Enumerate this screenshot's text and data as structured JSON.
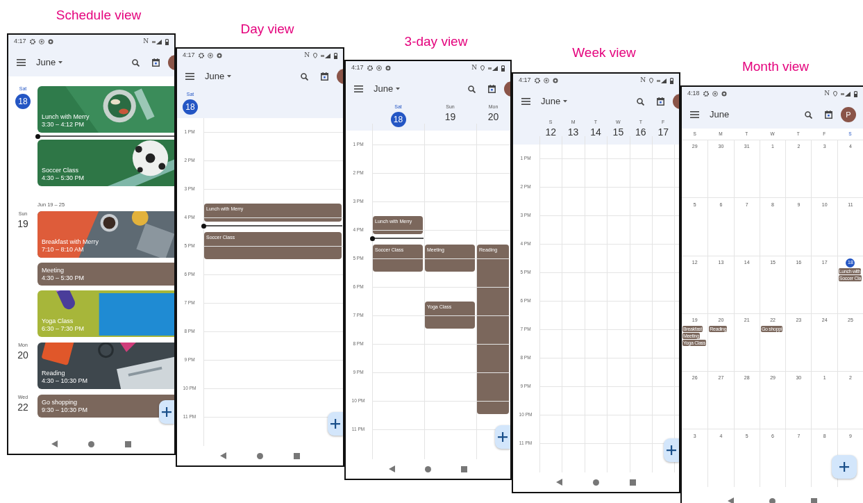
{
  "views": [
    {
      "kind": "schedule",
      "caption": "Schedule view",
      "time": "4:17",
      "nfc": "N",
      "location": false,
      "month": "June",
      "dropdown": true,
      "agenda": [
        {
          "kind": "day",
          "weekday": "Sat",
          "date": "18",
          "today": true,
          "events": [
            {
              "kind": "picture",
              "title": "Lunch with Merry",
              "time": "3:30 – 4:12 PM"
            },
            {
              "kind": "now"
            },
            {
              "kind": "picture",
              "title": "Soccer Class",
              "time": "4:30 – 5:30 PM"
            }
          ]
        },
        {
          "kind": "range",
          "label": "Jun 19 – 25"
        },
        {
          "kind": "day",
          "weekday": "Sun",
          "date": "19",
          "today": false,
          "events": [
            {
              "kind": "picture",
              "title": "Breakfast with Merry",
              "time": "7:10 – 8:10 AM"
            },
            {
              "kind": "plain",
              "title": "Meeting",
              "time": "4:30 – 5:30 PM"
            },
            {
              "kind": "picture",
              "title": "Yoga Class",
              "time": "6:30 – 7:30 PM"
            }
          ]
        },
        {
          "kind": "day",
          "weekday": "Mon",
          "date": "20",
          "today": false,
          "events": [
            {
              "kind": "picture",
              "title": "Reading",
              "time": "4:30 – 10:30 PM"
            }
          ]
        },
        {
          "kind": "day",
          "weekday": "Wed",
          "date": "22",
          "today": false,
          "events": [
            {
              "kind": "plain",
              "title": "Go shopping",
              "time": "9:30 – 10:30 PM"
            }
          ]
        }
      ]
    },
    {
      "kind": "day",
      "caption": "Day view",
      "time": "4:17",
      "nfc": "N",
      "location": true,
      "month": "June",
      "dropdown": true,
      "hours": [
        "1 PM",
        "2 PM",
        "3 PM",
        "4 PM",
        "5 PM",
        "6 PM",
        "7 PM",
        "8 PM",
        "9 PM",
        "10 PM",
        "11 PM"
      ],
      "days": [
        {
          "weekday": "Sat",
          "date": "18",
          "today": true,
          "now_line": true,
          "events": [
            {
              "title": "Lunch with Merry"
            },
            {
              "title": "Soccer Class"
            }
          ]
        }
      ]
    },
    {
      "kind": "threeday",
      "caption": "3-day view",
      "time": "4:17",
      "nfc": "N",
      "location": true,
      "month": "June",
      "dropdown": true,
      "hours": [
        "1 PM",
        "2 PM",
        "3 PM",
        "4 PM",
        "5 PM",
        "6 PM",
        "7 PM",
        "8 PM",
        "9 PM",
        "10 PM",
        "11 PM"
      ],
      "days": [
        {
          "weekday": "Sat",
          "date": "18",
          "today": true,
          "now_line": true,
          "events": [
            {
              "title": "Lunch with Merry"
            },
            {
              "title": "Soccer Class"
            }
          ]
        },
        {
          "weekday": "Sun",
          "date": "19",
          "today": false,
          "now_line": false,
          "events": [
            {
              "title": "Meeting"
            },
            {
              "title": "Yoga Class"
            }
          ]
        },
        {
          "weekday": "Mon",
          "date": "20",
          "today": false,
          "now_line": false,
          "events": [
            {
              "title": "Reading"
            }
          ]
        }
      ]
    },
    {
      "kind": "week",
      "caption": "Week view",
      "time": "4:17",
      "nfc": "N",
      "location": true,
      "month": "June",
      "dropdown": true,
      "hours": [
        "1 PM",
        "2 PM",
        "3 PM",
        "4 PM",
        "5 PM",
        "6 PM",
        "7 PM",
        "8 PM",
        "9 PM",
        "10 PM",
        "11 PM"
      ],
      "days": [
        {
          "weekday": "S",
          "date": "12",
          "today": false,
          "now_line": false
        },
        {
          "weekday": "M",
          "date": "13",
          "today": false,
          "now_line": false
        },
        {
          "weekday": "T",
          "date": "14",
          "today": false,
          "now_line": false
        },
        {
          "weekday": "W",
          "date": "15",
          "today": false,
          "now_line": false
        },
        {
          "weekday": "T",
          "date": "16",
          "today": false,
          "now_line": false
        },
        {
          "weekday": "F",
          "date": "17",
          "today": false,
          "now_line": false
        }
      ]
    },
    {
      "kind": "month",
      "caption": "Month view",
      "time": "4:18",
      "nfc": "N",
      "location": true,
      "month": "June",
      "dropdown": false,
      "avatar": "P",
      "weekdays": [
        {
          "label": "S",
          "today": false
        },
        {
          "label": "M",
          "today": false
        },
        {
          "label": "T",
          "today": false
        },
        {
          "label": "W",
          "today": false
        },
        {
          "label": "T",
          "today": false
        },
        {
          "label": "F",
          "today": false
        },
        {
          "label": "S",
          "today": true
        }
      ],
      "weeks": [
        [
          {
            "date": "29",
            "today": false
          },
          {
            "date": "30",
            "today": false
          },
          {
            "date": "31",
            "today": false
          },
          {
            "date": "1",
            "today": false
          },
          {
            "date": "2",
            "today": false
          },
          {
            "date": "3",
            "today": false
          },
          {
            "date": "4",
            "today": false
          }
        ],
        [
          {
            "date": "5",
            "today": false
          },
          {
            "date": "6",
            "today": false
          },
          {
            "date": "7",
            "today": false
          },
          {
            "date": "8",
            "today": false
          },
          {
            "date": "9",
            "today": false
          },
          {
            "date": "10",
            "today": false
          },
          {
            "date": "11",
            "today": false
          }
        ],
        [
          {
            "date": "12",
            "today": false
          },
          {
            "date": "13",
            "today": false
          },
          {
            "date": "14",
            "today": false
          },
          {
            "date": "15",
            "today": false
          },
          {
            "date": "16",
            "today": false
          },
          {
            "date": "17",
            "today": false
          },
          {
            "date": "18",
            "today": true,
            "events": [
              "Lunch with",
              "Soccer Cla"
            ]
          }
        ],
        [
          {
            "date": "19",
            "today": false,
            "events": [
              "Breakfast",
              "Meeting",
              "Yoga Class"
            ]
          },
          {
            "date": "20",
            "today": false,
            "events": [
              "Reading"
            ]
          },
          {
            "date": "21",
            "today": false
          },
          {
            "date": "22",
            "today": false,
            "events": [
              "Go shoppi"
            ]
          },
          {
            "date": "23",
            "today": false
          },
          {
            "date": "24",
            "today": false
          },
          {
            "date": "25",
            "today": false
          }
        ],
        [
          {
            "date": "26",
            "today": false
          },
          {
            "date": "27",
            "today": false
          },
          {
            "date": "28",
            "today": false
          },
          {
            "date": "29",
            "today": false
          },
          {
            "date": "30",
            "today": false
          },
          {
            "date": "1",
            "today": false
          },
          {
            "date": "2",
            "today": false
          }
        ],
        [
          {
            "date": "3",
            "today": false
          },
          {
            "date": "4",
            "today": false
          },
          {
            "date": "5",
            "today": false
          },
          {
            "date": "6",
            "today": false
          },
          {
            "date": "7",
            "today": false
          },
          {
            "date": "8",
            "today": false
          },
          {
            "date": "9",
            "today": false
          }
        ]
      ]
    }
  ]
}
